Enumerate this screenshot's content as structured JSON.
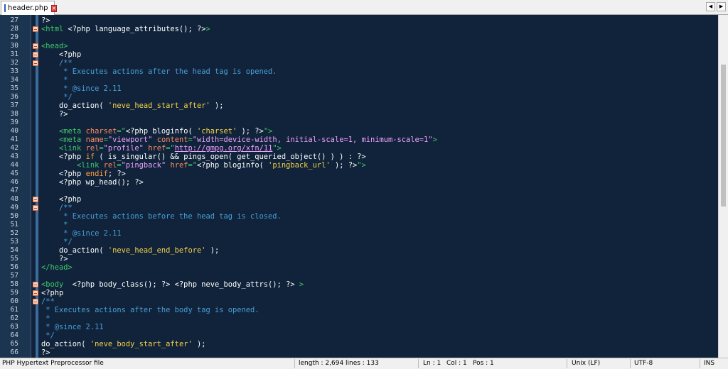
{
  "tab": {
    "name": "header.php"
  },
  "nav": {
    "left": "◀",
    "right": "▶"
  },
  "lines": [
    {
      "n": "27",
      "fold": false,
      "seg": [
        [
          "pi",
          "?>"
        ]
      ]
    },
    {
      "n": "28",
      "fold": true,
      "seg": [
        [
          "tag",
          "<html"
        ],
        [
          "pi",
          " <?php language_attributes(); ?>"
        ],
        [
          "tag",
          ">"
        ]
      ]
    },
    {
      "n": "29",
      "fold": false,
      "seg": []
    },
    {
      "n": "30",
      "fold": true,
      "seg": [
        [
          "tag",
          "<head>"
        ]
      ]
    },
    {
      "n": "31",
      "fold": true,
      "seg": [
        [
          "pi",
          "    <?php"
        ]
      ]
    },
    {
      "n": "32",
      "fold": true,
      "seg": [
        [
          "cm",
          "    /**"
        ]
      ]
    },
    {
      "n": "33",
      "fold": false,
      "seg": [
        [
          "cm",
          "     * Executes actions after the head tag is opened."
        ]
      ]
    },
    {
      "n": "34",
      "fold": false,
      "seg": [
        [
          "cm",
          "     *"
        ]
      ]
    },
    {
      "n": "35",
      "fold": false,
      "seg": [
        [
          "cm",
          "     * @since 2.11"
        ]
      ]
    },
    {
      "n": "36",
      "fold": false,
      "seg": [
        [
          "cm",
          "     */"
        ]
      ]
    },
    {
      "n": "37",
      "fold": false,
      "seg": [
        [
          "fn",
          "    do_action( "
        ],
        [
          "str",
          "'neve_head_start_after'"
        ],
        [
          "fn",
          " );"
        ]
      ]
    },
    {
      "n": "38",
      "fold": false,
      "seg": [
        [
          "pi",
          "    ?>"
        ]
      ]
    },
    {
      "n": "39",
      "fold": false,
      "seg": []
    },
    {
      "n": "40",
      "fold": false,
      "seg": [
        [
          "tag",
          "    <meta "
        ],
        [
          "attr",
          "charset"
        ],
        [
          "tag",
          "=\""
        ],
        [
          "pi",
          "<?php bloginfo( "
        ],
        [
          "str",
          "'charset'"
        ],
        [
          "pi",
          " ); ?>"
        ],
        [
          "tag",
          "\">"
        ]
      ]
    },
    {
      "n": "41",
      "fold": false,
      "seg": [
        [
          "tag",
          "    <meta "
        ],
        [
          "attr",
          "name"
        ],
        [
          "tag",
          "="
        ],
        [
          "aval",
          "\"viewport\""
        ],
        [
          "tag",
          " "
        ],
        [
          "attr",
          "content"
        ],
        [
          "tag",
          "="
        ],
        [
          "aval",
          "\"width=device-width, initial-scale=1, minimum-scale=1\""
        ],
        [
          "tag",
          ">"
        ]
      ]
    },
    {
      "n": "42",
      "fold": false,
      "seg": [
        [
          "tag",
          "    <link "
        ],
        [
          "attr",
          "rel"
        ],
        [
          "tag",
          "="
        ],
        [
          "aval",
          "\"profile\""
        ],
        [
          "tag",
          " "
        ],
        [
          "attr",
          "href"
        ],
        [
          "tag",
          "=\""
        ],
        [
          "url",
          "http://gmpg.org/xfn/11"
        ],
        [
          "tag",
          "\">"
        ]
      ]
    },
    {
      "n": "43",
      "fold": false,
      "seg": [
        [
          "pi",
          "    <?php "
        ],
        [
          "kw",
          "if"
        ],
        [
          "pi",
          " ( is_singular() && pings_open( get_queried_object() ) ) : ?>"
        ]
      ]
    },
    {
      "n": "44",
      "fold": false,
      "seg": [
        [
          "tag",
          "        <link "
        ],
        [
          "attr",
          "rel"
        ],
        [
          "tag",
          "="
        ],
        [
          "aval",
          "\"pingback\""
        ],
        [
          "tag",
          " "
        ],
        [
          "attr",
          "href"
        ],
        [
          "tag",
          "=\""
        ],
        [
          "pi",
          "<?php bloginfo( "
        ],
        [
          "str",
          "'pingback_url'"
        ],
        [
          "pi",
          " ); ?>"
        ],
        [
          "tag",
          "\">"
        ]
      ]
    },
    {
      "n": "45",
      "fold": false,
      "seg": [
        [
          "pi",
          "    <?php "
        ],
        [
          "kw",
          "endif"
        ],
        [
          "pi",
          "; ?>"
        ]
      ]
    },
    {
      "n": "46",
      "fold": false,
      "seg": [
        [
          "pi",
          "    <?php wp_head(); ?>"
        ]
      ]
    },
    {
      "n": "47",
      "fold": false,
      "seg": []
    },
    {
      "n": "48",
      "fold": true,
      "seg": [
        [
          "pi",
          "    <?php"
        ]
      ]
    },
    {
      "n": "49",
      "fold": true,
      "seg": [
        [
          "cm",
          "    /**"
        ]
      ]
    },
    {
      "n": "50",
      "fold": false,
      "seg": [
        [
          "cm",
          "     * Executes actions before the head tag is closed."
        ]
      ]
    },
    {
      "n": "51",
      "fold": false,
      "seg": [
        [
          "cm",
          "     *"
        ]
      ]
    },
    {
      "n": "52",
      "fold": false,
      "seg": [
        [
          "cm",
          "     * @since 2.11"
        ]
      ]
    },
    {
      "n": "53",
      "fold": false,
      "seg": [
        [
          "cm",
          "     */"
        ]
      ]
    },
    {
      "n": "54",
      "fold": false,
      "seg": [
        [
          "fn",
          "    do_action( "
        ],
        [
          "str",
          "'neve_head_end_before'"
        ],
        [
          "fn",
          " );"
        ]
      ]
    },
    {
      "n": "55",
      "fold": false,
      "seg": [
        [
          "pi",
          "    ?>"
        ]
      ]
    },
    {
      "n": "56",
      "fold": false,
      "seg": [
        [
          "tag",
          "</head>"
        ]
      ]
    },
    {
      "n": "57",
      "fold": false,
      "seg": []
    },
    {
      "n": "58",
      "fold": true,
      "seg": [
        [
          "tag",
          "<body"
        ],
        [
          "pi",
          "  <?php body_class(); ?> <?php neve_body_attrs(); ?> "
        ],
        [
          "tag",
          ">"
        ]
      ]
    },
    {
      "n": "59",
      "fold": true,
      "seg": [
        [
          "pi",
          "<?php"
        ]
      ]
    },
    {
      "n": "60",
      "fold": true,
      "seg": [
        [
          "cm",
          "/**"
        ]
      ]
    },
    {
      "n": "61",
      "fold": false,
      "seg": [
        [
          "cm",
          " * Executes actions after the body tag is opened."
        ]
      ]
    },
    {
      "n": "62",
      "fold": false,
      "seg": [
        [
          "cm",
          " *"
        ]
      ]
    },
    {
      "n": "63",
      "fold": false,
      "seg": [
        [
          "cm",
          " * @since 2.11"
        ]
      ]
    },
    {
      "n": "64",
      "fold": false,
      "seg": [
        [
          "cm",
          " */"
        ]
      ]
    },
    {
      "n": "65",
      "fold": false,
      "seg": [
        [
          "fn",
          "do_action( "
        ],
        [
          "str",
          "'neve_body_start_after'"
        ],
        [
          "fn",
          " );"
        ]
      ]
    },
    {
      "n": "66",
      "fold": false,
      "seg": [
        [
          "pi",
          "?>"
        ]
      ]
    }
  ],
  "status": {
    "filetype": "PHP Hypertext Preprocessor file",
    "length": "length : 2,694",
    "lines": "lines : 133",
    "ln": "Ln : 1",
    "col": "Col : 1",
    "pos": "Pos : 1",
    "eol": "Unix (LF)",
    "encoding": "UTF-8",
    "mode": "INS"
  }
}
